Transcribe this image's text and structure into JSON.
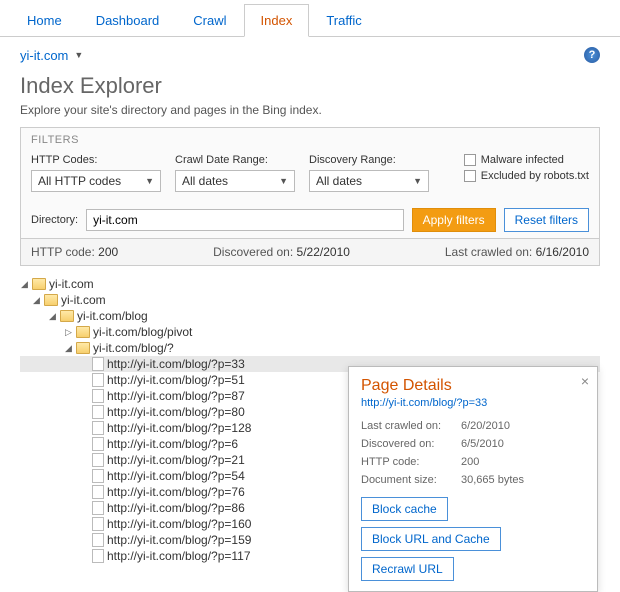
{
  "tabs": [
    "Home",
    "Dashboard",
    "Crawl",
    "Index",
    "Traffic"
  ],
  "activeTab": "Index",
  "site": "yi-it.com",
  "title": "Index Explorer",
  "subtitle": "Explore your site's directory and pages in the Bing index.",
  "filters": {
    "header": "FILTERS",
    "http_label": "HTTP Codes:",
    "http_value": "All HTTP codes",
    "crawl_label": "Crawl Date Range:",
    "crawl_value": "All dates",
    "disc_label": "Discovery Range:",
    "disc_value": "All dates",
    "malware": "Malware infected",
    "robots": "Excluded by robots.txt",
    "dir_label": "Directory:",
    "dir_value": "yi-it.com",
    "apply": "Apply filters",
    "reset": "Reset filters"
  },
  "info": {
    "http_l": "HTTP code:",
    "http_v": "200",
    "disc_l": "Discovered on:",
    "disc_v": "5/22/2010",
    "crawl_l": "Last crawled on:",
    "crawl_v": "6/16/2010"
  },
  "tree": {
    "root": "yi-it.com",
    "n1": "yi-it.com",
    "n2": "yi-it.com/blog",
    "n3": "yi-it.com/blog/pivot",
    "n4": "yi-it.com/blog/?",
    "pages": [
      "http://yi-it.com/blog/?p=33",
      "http://yi-it.com/blog/?p=51",
      "http://yi-it.com/blog/?p=87",
      "http://yi-it.com/blog/?p=80",
      "http://yi-it.com/blog/?p=128",
      "http://yi-it.com/blog/?p=6",
      "http://yi-it.com/blog/?p=21",
      "http://yi-it.com/blog/?p=54",
      "http://yi-it.com/blog/?p=76",
      "http://yi-it.com/blog/?p=86",
      "http://yi-it.com/blog/?p=160",
      "http://yi-it.com/blog/?p=159",
      "http://yi-it.com/blog/?p=117"
    ]
  },
  "popup": {
    "title": "Page Details",
    "url": "http://yi-it.com/blog/?p=33",
    "lastcrawl_l": "Last crawled on:",
    "lastcrawl_v": "6/20/2010",
    "disc_l": "Discovered on:",
    "disc_v": "6/5/2010",
    "http_l": "HTTP code:",
    "http_v": "200",
    "size_l": "Document size:",
    "size_v": "30,665 bytes",
    "block_cache": "Block cache",
    "block_url": "Block URL and Cache",
    "recrawl": "Recrawl URL"
  }
}
